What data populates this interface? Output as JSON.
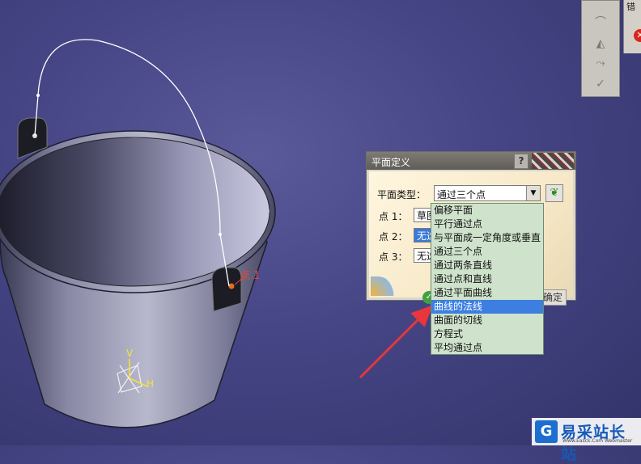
{
  "viewport": {
    "point_label": "点.1",
    "axis_v": "V",
    "axis_h": "H"
  },
  "top_right_panel": {
    "label": "错",
    "error_icon": "error-x-icon"
  },
  "toolbar": {
    "icons": [
      "curve-icon",
      "surface-icon",
      "sweep-icon",
      "check-icon"
    ]
  },
  "dialog": {
    "title": "平面定义",
    "help": "?",
    "plane_type_label": "平面类型：",
    "plane_type_value": "通过三个点",
    "point1_label": "点 1：",
    "point1_value": "草图",
    "point2_label": "点 2：",
    "point2_value": "无选",
    "point3_label": "点 3：",
    "point3_value": "无选",
    "cancel_label": "确定"
  },
  "dropdown": {
    "options": [
      "偏移平面",
      "平行通过点",
      "与平面成一定角度或垂直",
      "通过三个点",
      "通过两条直线",
      "通过点和直线",
      "通过平面曲线",
      "曲线的法线",
      "曲面的切线",
      "方程式",
      "平均通过点"
    ],
    "highlighted_index": 7
  },
  "watermark": {
    "logo": "G",
    "text": "易采站长站",
    "sub": "Www.Easck.Com Webmaster"
  },
  "colors": {
    "background": "#454585",
    "dropdown_bg": "#cfe3cc",
    "highlight": "#3d7fe0",
    "arrow": "#e8363a"
  }
}
